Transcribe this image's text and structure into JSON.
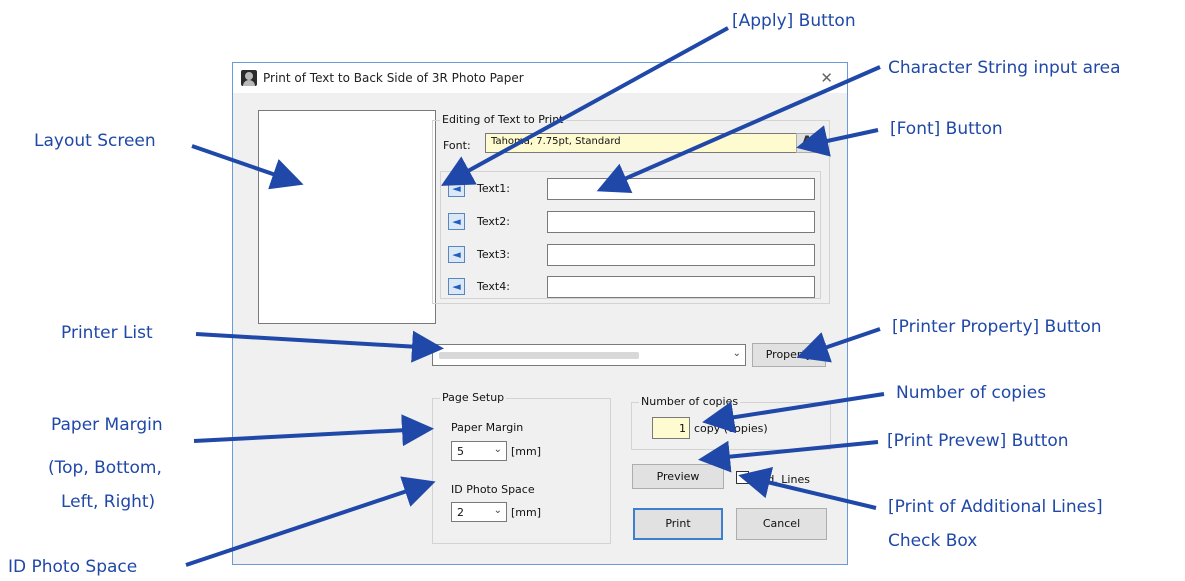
{
  "callouts": {
    "apply_button": "[Apply] Button",
    "char_input": "Character String input area",
    "font_button": "[Font] Button",
    "layout_screen": "Layout Screen",
    "printer_list": "Printer List",
    "printer_property": "[Printer Property] Button",
    "number_copies": "Number of copies",
    "paper_margin_1": "Paper Margin",
    "paper_margin_2": "(Top, Bottom,",
    "paper_margin_3": "Left, Right)",
    "print_preview": "[Print Prevew] Button",
    "additional_lines_1": "[Print of Additional Lines]",
    "additional_lines_2": "Check Box",
    "id_photo_space": "ID Photo Space"
  },
  "dialog": {
    "title": "Print of Text to Back Side of 3R Photo Paper",
    "close": "✕",
    "editing_group": "Editing of Text to Print",
    "font_label": "Font:",
    "font_value": "Tahoma, 7.75pt, Standard",
    "font_button_glyph": "A",
    "texts": [
      {
        "label": "Text1:",
        "value": ""
      },
      {
        "label": "Text2:",
        "value": ""
      },
      {
        "label": "Text3:",
        "value": ""
      },
      {
        "label": "Text4:",
        "value": ""
      }
    ],
    "apply_glyph": "◄",
    "property_button": "Property",
    "page_setup_group": "Page Setup",
    "paper_margin_label": "Paper Margin",
    "paper_margin_value": "5",
    "mm_unit": "[mm]",
    "id_photo_label": "ID Photo Space",
    "id_photo_value": "2",
    "copies_group": "Number of copies",
    "copies_value": "1",
    "copies_unit": "copy (copies)",
    "preview_button": "Preview",
    "add_lines_label": "Add. Lines",
    "print_button": "Print",
    "cancel_button": "Cancel"
  },
  "colors": {
    "callout_text": "#1f48a8",
    "arrow": "#1f48a8",
    "font_field_bg": "#fffbd0",
    "copies_field_bg": "#fffbd0"
  }
}
